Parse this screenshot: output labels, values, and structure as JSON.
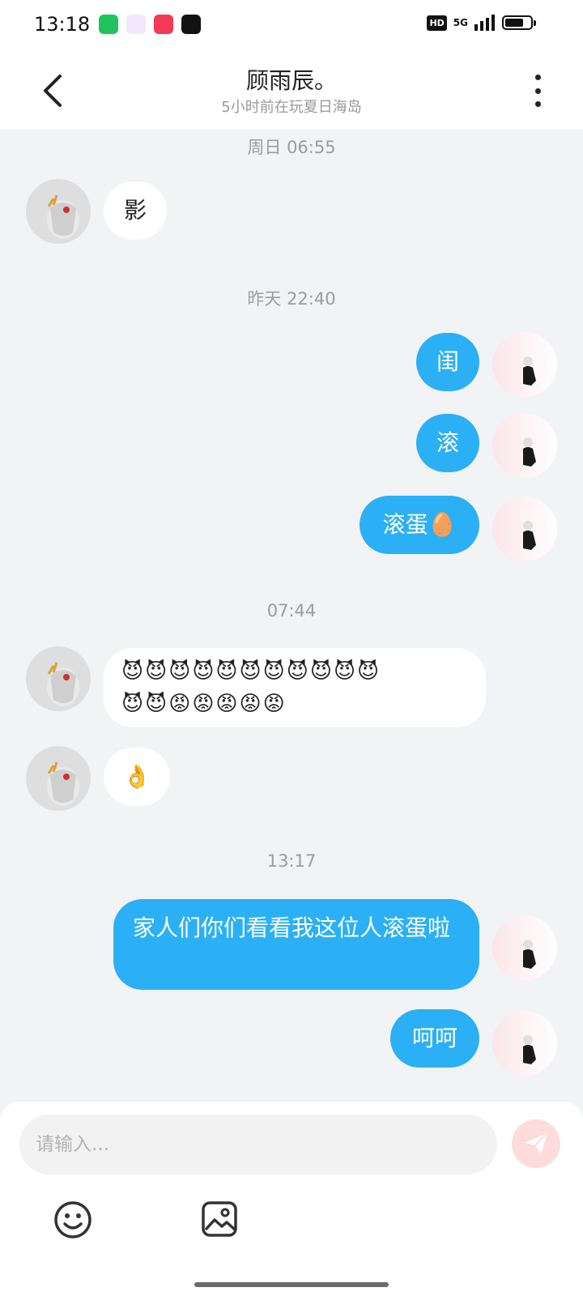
{
  "status_bar": {
    "time": "13:18",
    "hd": "HD",
    "network": "5G",
    "app_icons": [
      "phone-app-icon",
      "cloud-app-icon",
      "video-app-icon",
      "capcut-app-icon"
    ]
  },
  "header": {
    "title": "顾雨辰。",
    "subtitle": "5小时前在玩夏日海岛"
  },
  "messages": {
    "ts1": "周日 06:55",
    "m1": "影",
    "ts2": "昨天 22:40",
    "m2": "闺",
    "m3": "滚",
    "m4": "滚蛋🥚",
    "ts3": "07:44",
    "m5_line1": "😈😈😈😈😈😈😈😈😈😈😈",
    "m5_line2": "😈😈😡😡😡😡😡",
    "m6": "👌",
    "ts4": "13:17",
    "m7": "家人们你们看看我这位人滚蛋啦",
    "m8": "呵呵"
  },
  "composer": {
    "placeholder": "请输入..."
  },
  "colors": {
    "sent_bubble": "#2bb0f5",
    "received_bubble": "#ffffff",
    "background": "#f2f3f5",
    "send_button": "#fddcdb"
  }
}
